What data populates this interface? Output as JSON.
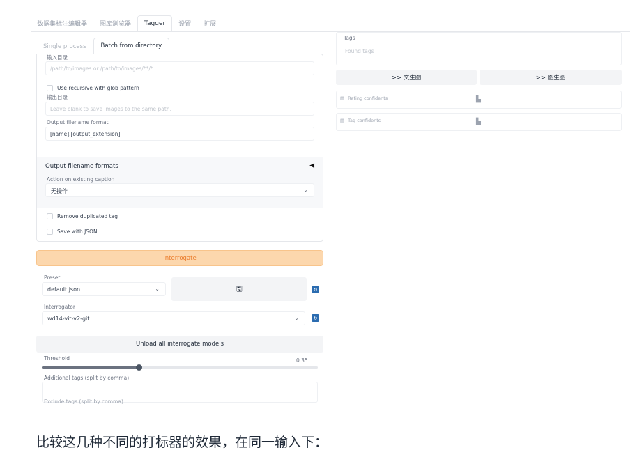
{
  "top_tabs": [
    "数据集标注编辑器",
    "图库浏览器",
    "Tagger",
    "设置",
    "扩展"
  ],
  "sub_tabs": [
    "Single process",
    "Batch from directory"
  ],
  "batch": {
    "input_dir_label": "输入目录",
    "input_dir_placeholder": "/path/to/images or /path/to/images/**/*",
    "recursive_label": "Use recursive with glob pattern",
    "output_dir_label": "输出目录",
    "output_dir_placeholder": "Leave blank to save images to the same path.",
    "output_filename_label": "Output filename format",
    "output_filename_value": "[name].[output_extension]"
  },
  "accordion": {
    "title": "Output filename formats",
    "arrow": "◀",
    "action_label": "Action on existing caption",
    "action_value": "无操作"
  },
  "checks": {
    "remove_dup": "Remove duplicated tag",
    "save_json": "Save with JSON"
  },
  "interrogate_label": "Interrogate",
  "preset": {
    "label": "Preset",
    "value": "default.json"
  },
  "interrogator": {
    "label": "Interrogator",
    "value": "wd14-vit-v2-git"
  },
  "unload_label": "Unload all interrogate models",
  "threshold": {
    "label": "Threshold",
    "value": "0.35",
    "fraction": 0.35
  },
  "additional_tags_label": "Additional tags (split by comma)",
  "exclude_tags_label": "Exclude tags (split by comma)",
  "right": {
    "tags_label": "Tags",
    "tags_placeholder": "Found tags",
    "to_txt2img": ">> 文生图",
    "to_img2img": ">> 图生图",
    "rating_label": "Rating confidents",
    "tag_conf_label": "Tag confidents"
  },
  "caption": "比较这几种不同的打标器的效果，在同一输入下："
}
